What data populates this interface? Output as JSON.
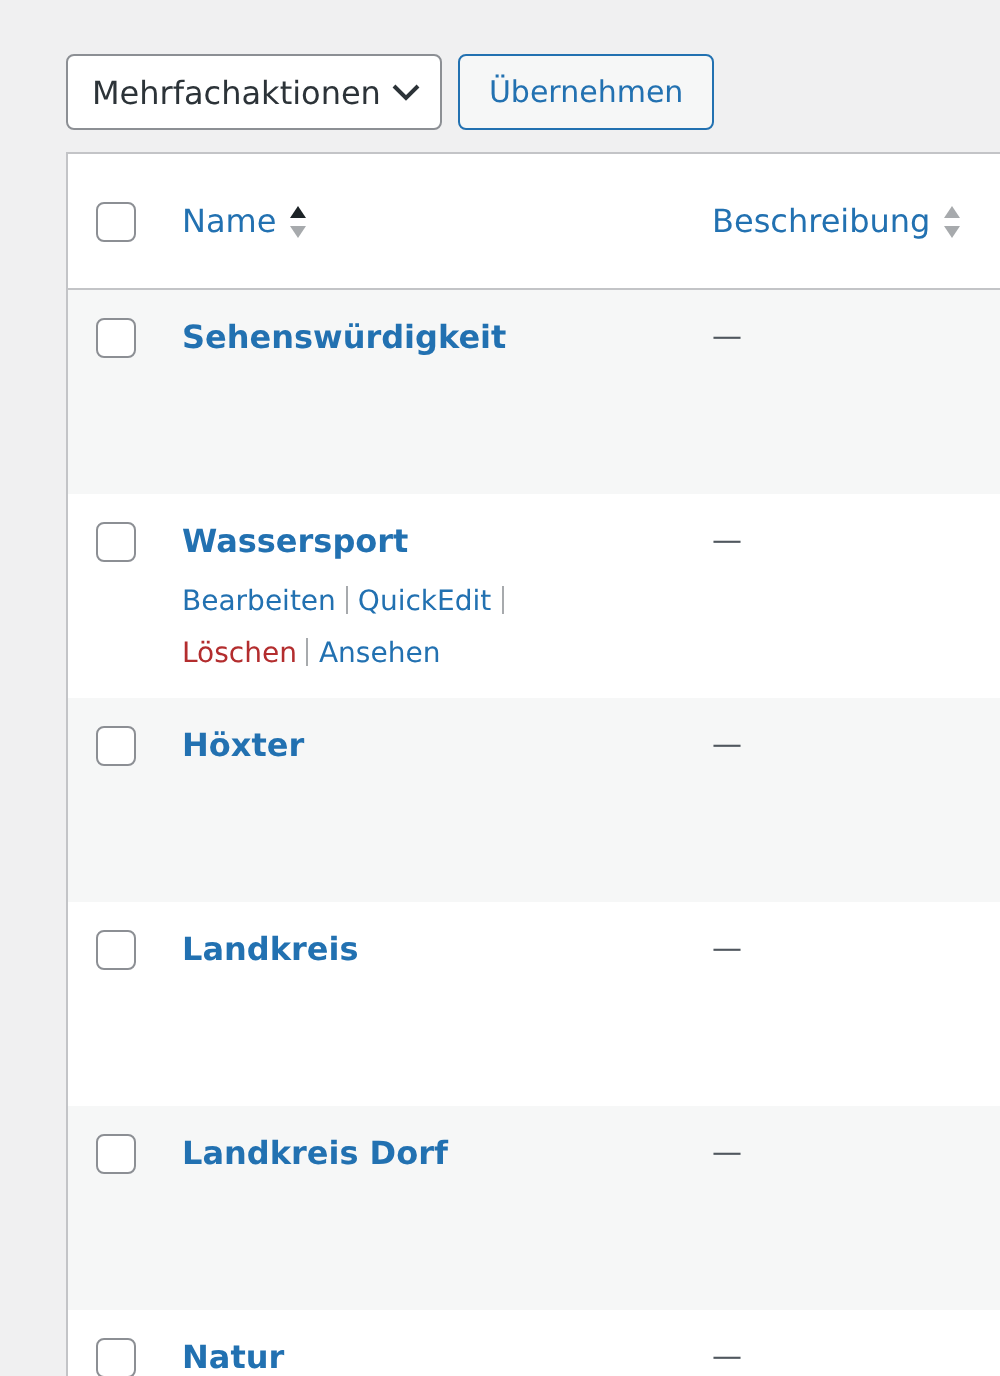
{
  "bulk_actions": {
    "value": "Mehrfachaktionen",
    "apply": "Übernehmen"
  },
  "table": {
    "select_all_checked": false,
    "columns": [
      {
        "label": "Name",
        "sorted": true
      },
      {
        "label": "Beschreibung",
        "sorted": false
      }
    ],
    "rows": [
      {
        "name": "Sehenswürdigkeit",
        "description": "—",
        "checked": false
      },
      {
        "name": "Wassersport",
        "description": "—",
        "checked": false,
        "actions": [
          {
            "label": "Bearbeiten",
            "kind": "normal"
          },
          {
            "label": "QuickEdit",
            "kind": "normal"
          },
          {
            "label": "Löschen",
            "kind": "delete"
          },
          {
            "label": "Ansehen",
            "kind": "normal"
          }
        ]
      },
      {
        "name": "Höxter",
        "description": "—",
        "checked": false
      },
      {
        "name": "Landkreis",
        "description": "—",
        "checked": false
      },
      {
        "name": "Landkreis Dorf",
        "description": "—",
        "checked": false
      },
      {
        "name": "Natur",
        "description": "—",
        "checked": false
      }
    ]
  }
}
